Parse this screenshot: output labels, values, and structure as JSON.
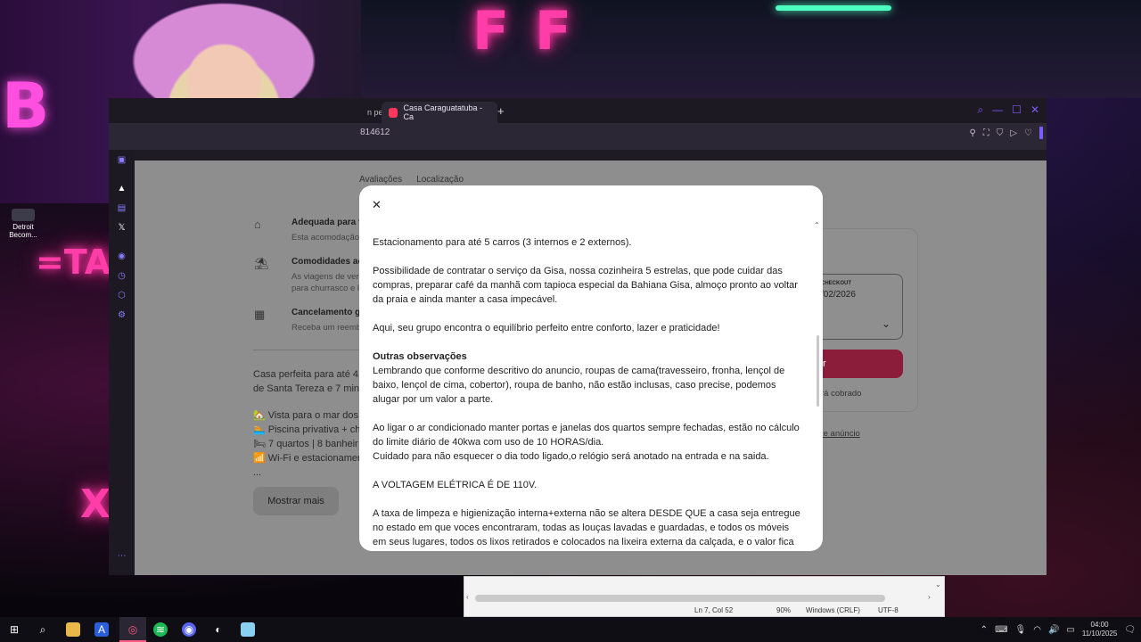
{
  "desktop": {
    "icon_label_1": "Detroit",
    "icon_label_2": "Becom..."
  },
  "browser": {
    "tab_partial": "n pe",
    "tab_title": "Casa Caraguatatuba - Ca",
    "url_fragment": "814612",
    "nav_tabs": [
      "Avaliações",
      "Localização"
    ]
  },
  "listing": {
    "amenities": [
      {
        "icon": "family-house-icon",
        "title": "Adequada para famí",
        "desc": "Esta acomodação"
      },
      {
        "icon": "beach-umbrella-icon",
        "title": "Comodidades ao ar",
        "desc": "As viagens de verão\npara churrasco e l"
      },
      {
        "icon": "calendar-icon",
        "title": "Cancelamento grátis",
        "desc": "Receba um reemb"
      }
    ],
    "description_lines": [
      "Casa perfeita para até 4",
      "de Santa Tereza e 7 min"
    ],
    "feature_lines": [
      "🏡 Vista para o mar dos",
      "🏊 Piscina privativa + ch",
      "🛏 7 quartos | 8 banheir",
      "📶 Wi-Fi e estacionamen",
      "..."
    ],
    "show_more_label": "Mostrar mais"
  },
  "booking": {
    "checkout_label": "CHECKOUT",
    "checkout_date": "/02/2026",
    "reserve_label": "r",
    "charged_note": "rá cobrado",
    "report_link": "te anúncio"
  },
  "modal": {
    "paragraphs": [
      "Estacionamento para até 5 carros (3 internos e 2 externos).",
      "Possibilidade de contratar o serviço da Gisa, nossa cozinheira 5 estrelas, que pode cuidar das compras, preparar café da manhã com tapioca especial da Bahiana Gisa, almoço pronto ao voltar da praia e ainda manter a casa impecável.",
      "Aqui, seu grupo encontra o equilíbrio perfeito entre conforto, lazer e praticidade!"
    ],
    "other_heading": "Outras observações",
    "other_paragraph": "Lembrando que conforme descritivo do anuncio, roupas de cama(travesseiro, fronha, lençol de baixo, lençol de cima, cobertor), roupa de banho, não estão inclusas, caso precise, podemos alugar por um valor a parte.",
    "ac_line_1": "Ao ligar o ar condicionado manter portas e janelas dos quartos sempre fechadas, estão no cálculo do limite diário de 40kwa com uso de 10 HORAS/dia.",
    "ac_line_2": "Cuidado para não esquecer o dia todo ligado,o relógio será anotado na entrada e na saida.",
    "voltage": "A VOLTAGEM ELÉTRICA É DE 110V.",
    "cleaning": "A taxa de limpeza e higienização interna+externa não se altera DESDE QUE a casa seja entregue no estado em que voces encontraram, todas as louças lavadas e guardadas, e todos os móveis em seus lugares, todos os lixos retirados e colocados na lixeira externa da calçada, e o valor fica"
  },
  "notepad": {
    "position": "Ln 7, Col 52",
    "zoom": "90%",
    "line_endings": "Windows (CRLF)",
    "encoding": "UTF-8"
  },
  "taskbar": {
    "time": "04:00",
    "date": "11/10/2025"
  },
  "colors": {
    "brand": "#ff385c",
    "accent": "#7d5bff"
  }
}
